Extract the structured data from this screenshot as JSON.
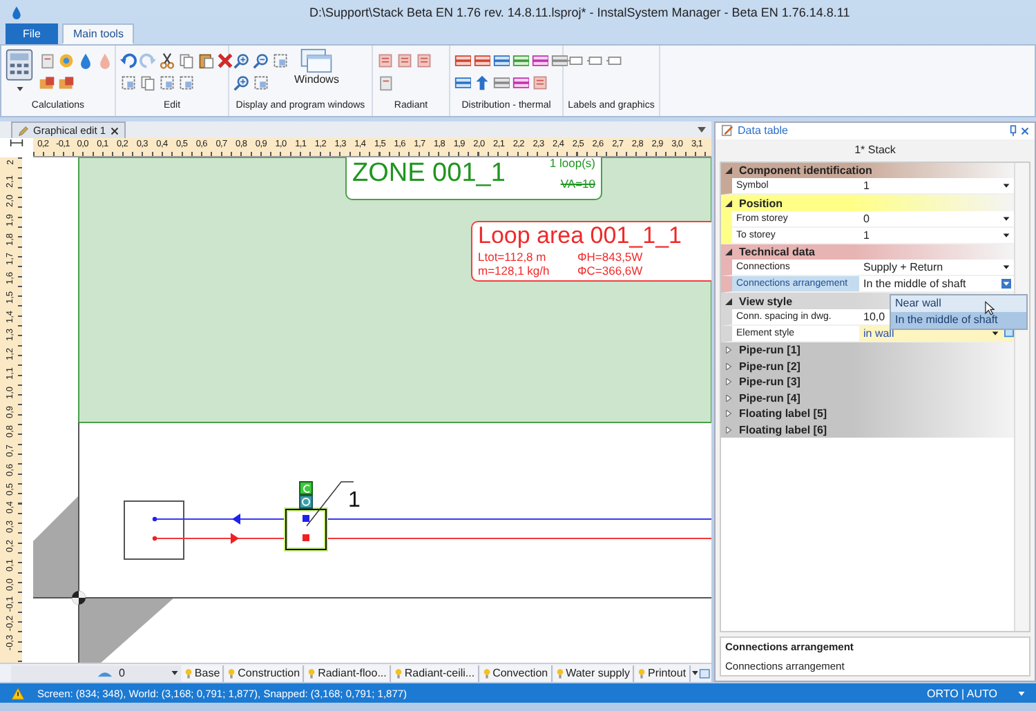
{
  "window": {
    "title": "D:\\Support\\Stack Beta EN 1.76 rev. 14.8.11.lsproj* - InstalSystem Manager - Beta EN 1.76.14.8.11"
  },
  "ribbon": {
    "tabs": [
      {
        "label": "File",
        "kind": "file",
        "selected": false
      },
      {
        "label": "Main tools",
        "kind": "tab",
        "selected": true
      }
    ],
    "groups": [
      {
        "label": "Calculations"
      },
      {
        "label": "Edit"
      },
      {
        "label": "Display and program windows",
        "button": "Windows"
      },
      {
        "label": "Radiant"
      },
      {
        "label": "Distribution - thermal"
      },
      {
        "label": "Labels and graphics"
      }
    ]
  },
  "document_tab": {
    "label": "Graphical edit 1"
  },
  "ruler": {
    "horizontal": [
      "0,2",
      "-0,1",
      "0,0",
      "0,1",
      "0,2",
      "0,3",
      "0,4",
      "0,5",
      "0,6",
      "0,7",
      "0,8",
      "0,9",
      "1,0",
      "1,1",
      "1,2",
      "1,3",
      "1,4",
      "1,5",
      "1,6",
      "1,7",
      "1,8",
      "1,9",
      "2,0",
      "2,1",
      "2,2",
      "2,3",
      "2,4",
      "2,5",
      "2,6",
      "2,7",
      "2,8",
      "2,9",
      "3,0",
      "3,1"
    ],
    "vertical": [
      "2",
      "2,1",
      "2,0",
      "1,9",
      "1,8",
      "1,7",
      "1,6",
      "1,5",
      "1,4",
      "1,3",
      "1,2",
      "1,1",
      "1,0",
      "0,9",
      "0,8",
      "0,7",
      "0,6",
      "0,5",
      "0,4",
      "0,3",
      "0,2",
      "0,1",
      "0,0",
      "-0,1",
      "-0,2",
      "-0,3"
    ]
  },
  "canvas": {
    "zone_label": {
      "title": "ZONE 001_1",
      "loops": "1 loop(s)",
      "va": "VA=10"
    },
    "loop_label": {
      "title": "Loop area 001_1_1",
      "lines": [
        "Ltot=112,8 m",
        "ΦH=843,5W",
        "m=128,1 kg/h",
        "ΦC=366,6W"
      ]
    },
    "stack_label": "1"
  },
  "layer_bar": {
    "layer": "0",
    "tabs": [
      {
        "label": "Base",
        "selected": false
      },
      {
        "label": "Construction",
        "selected": false
      },
      {
        "label": "Radiant-floo...",
        "selected": false
      },
      {
        "label": "Radiant-ceili...",
        "selected": false
      },
      {
        "label": "Convection",
        "selected": false
      },
      {
        "label": "Water supply",
        "selected": false
      },
      {
        "label": "Printout",
        "selected": false
      }
    ]
  },
  "data_table": {
    "title": "Data table",
    "object": "1* Stack",
    "sections": [
      {
        "title": "Component identification",
        "color": "#c9a796",
        "expanded": true,
        "rows": [
          {
            "name": "Symbol",
            "value": "1",
            "kind": "dropdown",
            "selected": false,
            "open": false
          }
        ]
      },
      {
        "title": "Position",
        "color": "#ffff88",
        "expanded": true,
        "rows": [
          {
            "name": "From storey",
            "value": "0",
            "kind": "dropdown",
            "selected": false,
            "open": false
          },
          {
            "name": "To storey",
            "value": "1",
            "kind": "dropdown",
            "selected": false,
            "open": false
          }
        ]
      },
      {
        "title": "Technical data",
        "color": "#e7b3b3",
        "expanded": true,
        "rows": [
          {
            "name": "Connections",
            "value": "Supply + Return",
            "kind": "dropdown",
            "selected": false,
            "open": false
          },
          {
            "name": "Connections arrangement",
            "value": "In the middle of shaft",
            "kind": "dropdown",
            "selected": true,
            "open": true
          }
        ]
      },
      {
        "title": "View style",
        "color": "#d6d6d6",
        "expanded": true,
        "rows": [
          {
            "name": "Conn. spacing in dwg.",
            "value": "10,0",
            "kind": "text",
            "selected": false,
            "open": false
          },
          {
            "name": "Element style",
            "value": "in wall",
            "kind": "style",
            "selected": false,
            "open": false
          }
        ]
      },
      {
        "title": "Pipe-run [1]",
        "color": "#c4c4c4",
        "expanded": false
      },
      {
        "title": "Pipe-run [2]",
        "color": "#c4c4c4",
        "expanded": false
      },
      {
        "title": "Pipe-run [3]",
        "color": "#c4c4c4",
        "expanded": false
      },
      {
        "title": "Pipe-run [4]",
        "color": "#c4c4c4",
        "expanded": false
      },
      {
        "title": "Floating label [5]",
        "color": "#c4c4c4",
        "expanded": false
      },
      {
        "title": "Floating label [6]",
        "color": "#c4c4c4",
        "expanded": false
      }
    ],
    "dropdown_options": [
      {
        "label": "Near wall",
        "selected": false
      },
      {
        "label": "In the middle of shaft",
        "selected": true
      }
    ],
    "description": {
      "title": "Connections arrangement",
      "text": "Connections arrangement"
    }
  },
  "status_bar": {
    "text": "Screen: (834; 348), World: (3,168; 0,791; 1,877), Snapped: (3,168; 0,791; 1,877)",
    "mode": "ORTO | AUTO"
  }
}
